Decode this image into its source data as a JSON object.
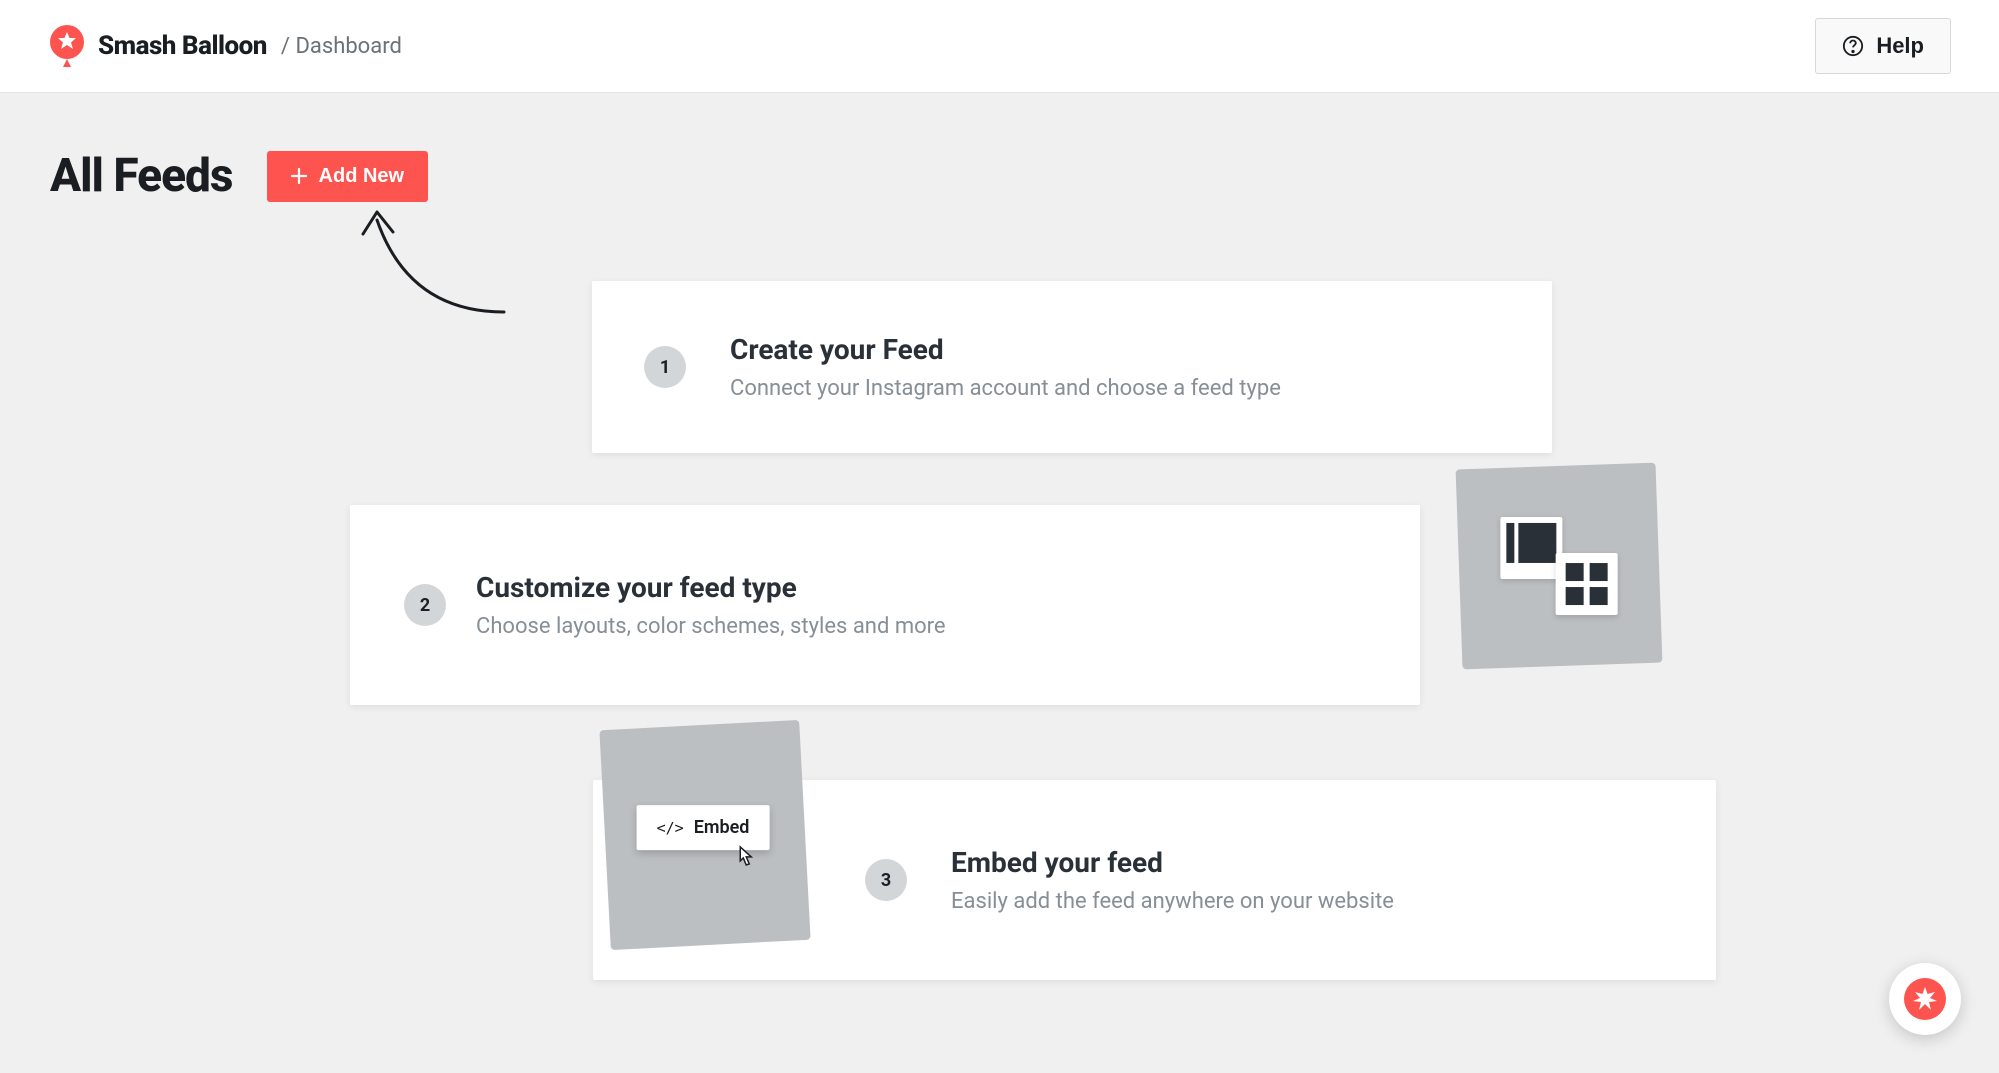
{
  "brand": {
    "name": "Smash Balloon",
    "accent_color": "#fe544f"
  },
  "breadcrumb": "/ Dashboard",
  "header": {
    "help_label": "Help"
  },
  "page": {
    "title": "All Feeds",
    "add_new_label": "Add New"
  },
  "steps": [
    {
      "number": "1",
      "title": "Create your Feed",
      "description": "Connect your Instagram account and choose a feed type"
    },
    {
      "number": "2",
      "title": "Customize your feed type",
      "description": "Choose layouts, color schemes, styles and more"
    },
    {
      "number": "3",
      "title": "Embed your feed",
      "description": "Easily add the feed anywhere on your website"
    }
  ],
  "embed_graphic": {
    "button_label": "Embed",
    "code_symbol": "</>"
  }
}
